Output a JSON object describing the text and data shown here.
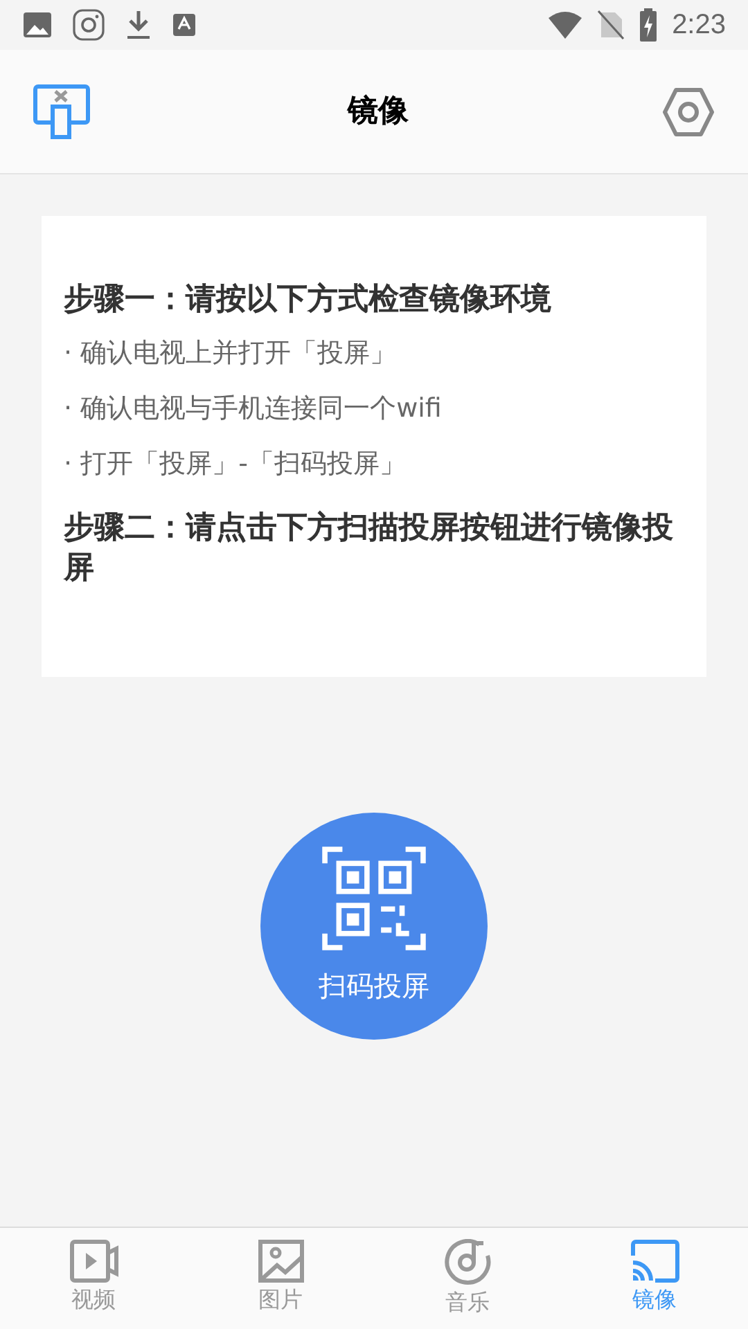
{
  "status_bar": {
    "time": "2:23"
  },
  "header": {
    "title": "镜像"
  },
  "card": {
    "steps": [
      {
        "title": "步骤一：请按以下方式检查镜像环境",
        "bullets": [
          "· 确认电视上并打开「投屏」",
          "· 确认电视与手机连接同一个wifi",
          "· 打开「投屏」-「扫码投屏」"
        ]
      },
      {
        "title": "步骤二：请点击下方扫描投屏按钮进行镜像投屏"
      }
    ]
  },
  "scan_button": {
    "label": "扫码投屏"
  },
  "tabs": [
    {
      "kind": "video",
      "label": "视频",
      "selected": false
    },
    {
      "kind": "picture",
      "label": "图片",
      "selected": false
    },
    {
      "kind": "music",
      "label": "音乐",
      "selected": false
    },
    {
      "kind": "mirror",
      "label": "镜像",
      "selected": true
    }
  ]
}
